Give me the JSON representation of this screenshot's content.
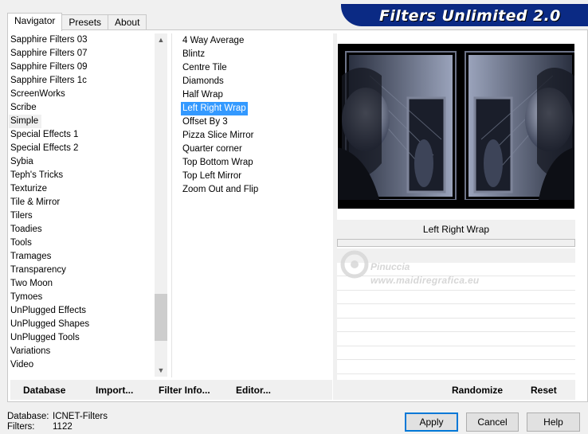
{
  "tabs": [
    {
      "label": "Navigator",
      "active": true
    },
    {
      "label": "Presets",
      "active": false
    },
    {
      "label": "About",
      "active": false
    }
  ],
  "banner": {
    "title": "Filters Unlimited 2.0",
    "color": "#0b2a84"
  },
  "categories": [
    "Sapphire Filters 03",
    "Sapphire Filters 07",
    "Sapphire Filters 09",
    "Sapphire Filters 1c",
    "ScreenWorks",
    "Scribe",
    "Simple",
    "Special Effects 1",
    "Special Effects 2",
    "Sybia",
    "Teph's Tricks",
    "Texturize",
    "Tile & Mirror",
    "Tilers",
    "Toadies",
    "Tools",
    "Tramages",
    "Transparency",
    "Two Moon",
    "Tymoes",
    "UnPlugged Effects",
    "UnPlugged Shapes",
    "UnPlugged Tools",
    "Variations",
    "Video"
  ],
  "selected_category": "Simple",
  "filters": [
    "4 Way Average",
    "Blintz",
    "Centre Tile",
    "Diamonds",
    "Half Wrap",
    "Left Right Wrap",
    "Offset By 3",
    "Pizza Slice Mirror",
    "Quarter corner",
    "Top Bottom Wrap",
    "Top Left Mirror",
    "Zoom Out and Flip"
  ],
  "selected_filter": "Left Right Wrap",
  "preview": {
    "filter_name": "Left Right Wrap"
  },
  "watermark": {
    "name": "Pinuccia",
    "url": "www.maidiregrafica.eu"
  },
  "toolbar_left": {
    "database": "Database",
    "import": "Import...",
    "filter_info": "Filter Info...",
    "editor": "Editor..."
  },
  "toolbar_right": {
    "randomize": "Randomize",
    "reset": "Reset"
  },
  "status": {
    "database_label": "Database:",
    "database_value": "ICNET-Filters",
    "filters_label": "Filters:",
    "filters_value": "1122"
  },
  "buttons": {
    "apply": "Apply",
    "cancel": "Cancel",
    "help": "Help"
  },
  "colors": {
    "selection": "#3399ff",
    "accent_border": "#0078d7"
  }
}
